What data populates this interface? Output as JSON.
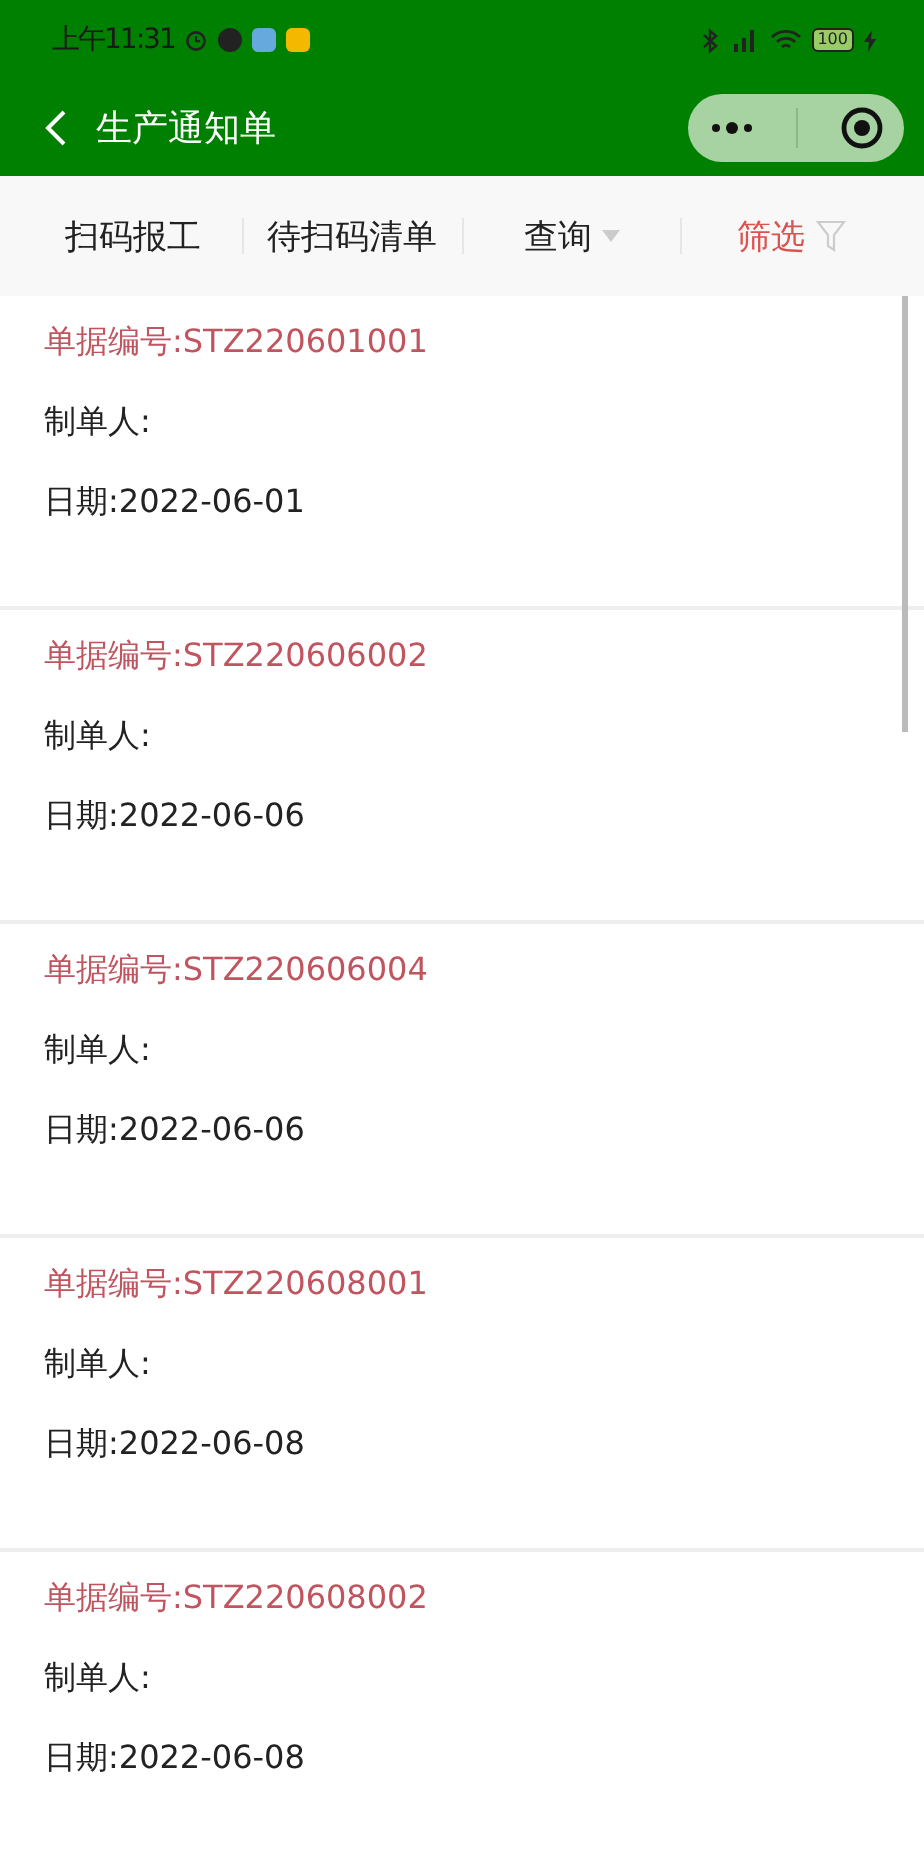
{
  "status_bar": {
    "time": "上午11:31",
    "battery": "100"
  },
  "header": {
    "title": "生产通知单"
  },
  "tabs": [
    {
      "label": "扫码报工",
      "kind": "plain"
    },
    {
      "label": "待扫码清单",
      "kind": "plain"
    },
    {
      "label": "查询",
      "kind": "dropdown"
    },
    {
      "label": "筛选",
      "kind": "filter"
    }
  ],
  "orders": [
    {
      "number": "单据编号:STZ220601001",
      "creator": "制单人:",
      "date": "日期:2022-06-01"
    },
    {
      "number": "单据编号:STZ220606002",
      "creator": "制单人:",
      "date": "日期:2022-06-06"
    },
    {
      "number": "单据编号:STZ220606004",
      "creator": "制单人:",
      "date": "日期:2022-06-06"
    },
    {
      "number": "单据编号:STZ220608001",
      "creator": "制单人:",
      "date": "日期:2022-06-08"
    },
    {
      "number": "单据编号:STZ220608002",
      "creator": "制单人:",
      "date": "日期:2022-06-08"
    }
  ]
}
